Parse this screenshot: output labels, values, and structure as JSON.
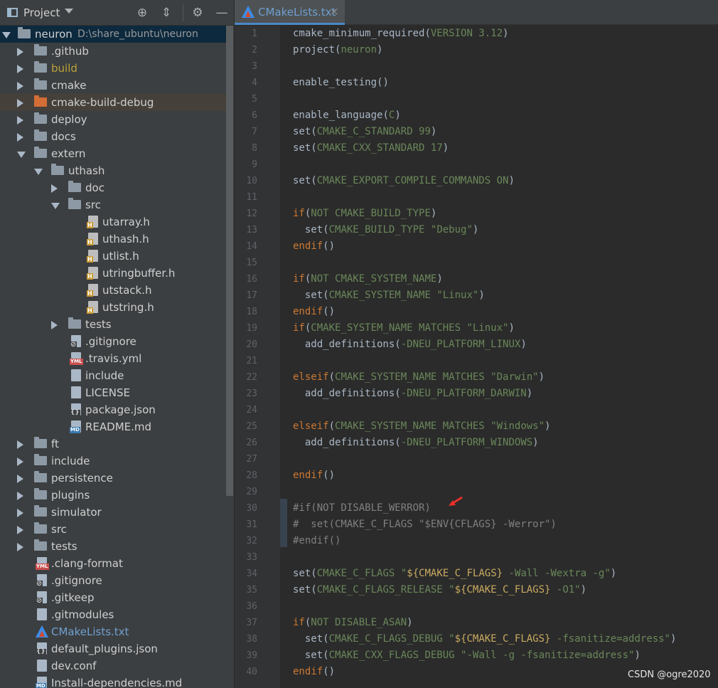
{
  "project": {
    "title": "Project",
    "root_label": "neuron",
    "root_path": "D:\\share_ubuntu\\neuron",
    "tree": [
      {
        "label": "neuron",
        "path": "D:\\share_ubuntu\\neuron",
        "depth": 0,
        "kind": "folder",
        "expanded": true,
        "selected": true
      },
      {
        "label": ".github",
        "depth": 1,
        "kind": "folder",
        "expanded": false
      },
      {
        "label": "build",
        "depth": 1,
        "kind": "folder",
        "expanded": false,
        "style": "build"
      },
      {
        "label": "cmake",
        "depth": 1,
        "kind": "folder",
        "expanded": false
      },
      {
        "label": "cmake-build-debug",
        "depth": 1,
        "kind": "folder",
        "expanded": false,
        "style": "orange",
        "highlight": true
      },
      {
        "label": "deploy",
        "depth": 1,
        "kind": "folder",
        "expanded": false
      },
      {
        "label": "docs",
        "depth": 1,
        "kind": "folder",
        "expanded": false
      },
      {
        "label": "extern",
        "depth": 1,
        "kind": "folder",
        "expanded": true
      },
      {
        "label": "uthash",
        "depth": 2,
        "kind": "folder",
        "expanded": true
      },
      {
        "label": "doc",
        "depth": 3,
        "kind": "folder",
        "expanded": false
      },
      {
        "label": "src",
        "depth": 3,
        "kind": "folder",
        "expanded": true
      },
      {
        "label": "utarray.h",
        "depth": 4,
        "kind": "h"
      },
      {
        "label": "uthash.h",
        "depth": 4,
        "kind": "h"
      },
      {
        "label": "utlist.h",
        "depth": 4,
        "kind": "h"
      },
      {
        "label": "utringbuffer.h",
        "depth": 4,
        "kind": "h"
      },
      {
        "label": "utstack.h",
        "depth": 4,
        "kind": "h"
      },
      {
        "label": "utstring.h",
        "depth": 4,
        "kind": "h"
      },
      {
        "label": "tests",
        "depth": 3,
        "kind": "folder",
        "expanded": false
      },
      {
        "label": ".gitignore",
        "depth": 3,
        "kind": "gitignore"
      },
      {
        "label": ".travis.yml",
        "depth": 3,
        "kind": "yml"
      },
      {
        "label": "include",
        "depth": 3,
        "kind": "text"
      },
      {
        "label": "LICENSE",
        "depth": 3,
        "kind": "text"
      },
      {
        "label": "package.json",
        "depth": 3,
        "kind": "json"
      },
      {
        "label": "README.md",
        "depth": 3,
        "kind": "md"
      },
      {
        "label": "ft",
        "depth": 1,
        "kind": "folder",
        "expanded": false
      },
      {
        "label": "include",
        "depth": 1,
        "kind": "folder",
        "expanded": false
      },
      {
        "label": "persistence",
        "depth": 1,
        "kind": "folder",
        "expanded": false
      },
      {
        "label": "plugins",
        "depth": 1,
        "kind": "folder",
        "expanded": false
      },
      {
        "label": "simulator",
        "depth": 1,
        "kind": "folder",
        "expanded": false
      },
      {
        "label": "src",
        "depth": 1,
        "kind": "folder",
        "expanded": false
      },
      {
        "label": "tests",
        "depth": 1,
        "kind": "folder",
        "expanded": false
      },
      {
        "label": ".clang-format",
        "depth": 1,
        "kind": "yml"
      },
      {
        "label": ".gitignore",
        "depth": 1,
        "kind": "gitignore"
      },
      {
        "label": ".gitkeep",
        "depth": 1,
        "kind": "gitignore"
      },
      {
        "label": ".gitmodules",
        "depth": 1,
        "kind": "text"
      },
      {
        "label": "CMakeLists.txt",
        "depth": 1,
        "kind": "cmake",
        "style": "cmlist"
      },
      {
        "label": "default_plugins.json",
        "depth": 1,
        "kind": "json"
      },
      {
        "label": "dev.conf",
        "depth": 1,
        "kind": "text"
      },
      {
        "label": "Install-dependencies.md",
        "depth": 1,
        "kind": "md"
      }
    ]
  },
  "editor": {
    "tab_label": "CMakeLists.txt",
    "tab_close": "×",
    "lines": [
      [
        [
          "fn",
          "cmake_minimum_required"
        ],
        [
          "p",
          "("
        ],
        [
          "arg",
          "VERSION 3.12"
        ],
        [
          "p",
          ")"
        ]
      ],
      [
        [
          "fn",
          "project"
        ],
        [
          "p",
          "("
        ],
        [
          "arg",
          "neuron"
        ],
        [
          "p",
          ")"
        ]
      ],
      [],
      [
        [
          "fn",
          "enable_testing"
        ],
        [
          "p",
          "()"
        ]
      ],
      [],
      [
        [
          "fn",
          "enable_language"
        ],
        [
          "p",
          "("
        ],
        [
          "arg",
          "C"
        ],
        [
          "p",
          ")"
        ]
      ],
      [
        [
          "fn",
          "set"
        ],
        [
          "p",
          "("
        ],
        [
          "arg",
          "CMAKE_C_STANDARD 99"
        ],
        [
          "p",
          ")"
        ]
      ],
      [
        [
          "fn",
          "set"
        ],
        [
          "p",
          "("
        ],
        [
          "arg",
          "CMAKE_CXX_STANDARD 17"
        ],
        [
          "p",
          ")"
        ]
      ],
      [],
      [
        [
          "fn",
          "set"
        ],
        [
          "p",
          "("
        ],
        [
          "arg",
          "CMAKE_EXPORT_COMPILE_COMMANDS ON"
        ],
        [
          "p",
          ")"
        ]
      ],
      [],
      [
        [
          "kw",
          "if"
        ],
        [
          "p",
          "("
        ],
        [
          "arg",
          "NOT CMAKE_BUILD_TYPE"
        ],
        [
          "p",
          ")"
        ]
      ],
      [
        [
          "p",
          "  "
        ],
        [
          "fn",
          "set"
        ],
        [
          "p",
          "("
        ],
        [
          "arg",
          "CMAKE_BUILD_TYPE "
        ],
        [
          "str",
          "\"Debug\""
        ],
        [
          "p",
          ")"
        ]
      ],
      [
        [
          "kw",
          "endif"
        ],
        [
          "p",
          "()"
        ]
      ],
      [],
      [
        [
          "kw",
          "if"
        ],
        [
          "p",
          "("
        ],
        [
          "arg",
          "NOT CMAKE_SYSTEM_NAME"
        ],
        [
          "p",
          ")"
        ]
      ],
      [
        [
          "p",
          "  "
        ],
        [
          "fn",
          "set"
        ],
        [
          "p",
          "("
        ],
        [
          "arg",
          "CMAKE_SYSTEM_NAME "
        ],
        [
          "str",
          "\"Linux\""
        ],
        [
          "p",
          ")"
        ]
      ],
      [
        [
          "kw",
          "endif"
        ],
        [
          "p",
          "()"
        ]
      ],
      [
        [
          "kw",
          "if"
        ],
        [
          "p",
          "("
        ],
        [
          "arg",
          "CMAKE_SYSTEM_NAME MATCHES "
        ],
        [
          "str",
          "\"Linux\""
        ],
        [
          "p",
          ")"
        ]
      ],
      [
        [
          "p",
          "  "
        ],
        [
          "fn",
          "add_definitions"
        ],
        [
          "p",
          "("
        ],
        [
          "arg",
          "-DNEU_PLATFORM_LINUX"
        ],
        [
          "p",
          ")"
        ]
      ],
      [],
      [
        [
          "kw",
          "elseif"
        ],
        [
          "p",
          "("
        ],
        [
          "arg",
          "CMAKE_SYSTEM_NAME MATCHES "
        ],
        [
          "str",
          "\"Darwin\""
        ],
        [
          "p",
          ")"
        ]
      ],
      [
        [
          "p",
          "  "
        ],
        [
          "fn",
          "add_definitions"
        ],
        [
          "p",
          "("
        ],
        [
          "arg",
          "-DNEU_PLATFORM_DARWIN"
        ],
        [
          "p",
          ")"
        ]
      ],
      [],
      [
        [
          "kw",
          "elseif"
        ],
        [
          "p",
          "("
        ],
        [
          "arg",
          "CMAKE_SYSTEM_NAME MATCHES "
        ],
        [
          "str",
          "\"Windows\""
        ],
        [
          "p",
          ")"
        ]
      ],
      [
        [
          "p",
          "  "
        ],
        [
          "fn",
          "add_definitions"
        ],
        [
          "p",
          "("
        ],
        [
          "arg",
          "-DNEU_PLATFORM_WINDOWS"
        ],
        [
          "p",
          ")"
        ]
      ],
      [],
      [
        [
          "kw",
          "endif"
        ],
        [
          "p",
          "()"
        ]
      ],
      [],
      [
        [
          "cm",
          "#if(NOT DISABLE_WERROR)"
        ]
      ],
      [
        [
          "cm",
          "#  set(CMAKE_C_FLAGS \"$ENV{CFLAGS} -Werror\")"
        ]
      ],
      [
        [
          "cm",
          "#endif()"
        ]
      ],
      [],
      [
        [
          "fn",
          "set"
        ],
        [
          "p",
          "("
        ],
        [
          "arg",
          "CMAKE_C_FLAGS "
        ],
        [
          "str",
          "\""
        ],
        [
          "def",
          "${CMAKE_C_FLAGS}"
        ],
        [
          "str",
          " -Wall -Wextra -g\""
        ],
        [
          "p",
          ")"
        ]
      ],
      [
        [
          "fn",
          "set"
        ],
        [
          "p",
          "("
        ],
        [
          "arg",
          "CMAKE_C_FLAGS_RELEASE "
        ],
        [
          "str",
          "\""
        ],
        [
          "def",
          "${CMAKE_C_FLAGS}"
        ],
        [
          "str",
          " -O1\""
        ],
        [
          "p",
          ")"
        ]
      ],
      [],
      [
        [
          "kw",
          "if"
        ],
        [
          "p",
          "("
        ],
        [
          "arg",
          "NOT DISABLE_ASAN"
        ],
        [
          "p",
          ")"
        ]
      ],
      [
        [
          "p",
          "  "
        ],
        [
          "fn",
          "set"
        ],
        [
          "p",
          "("
        ],
        [
          "arg",
          "CMAKE_C_FLAGS_DEBUG "
        ],
        [
          "str",
          "\""
        ],
        [
          "def",
          "${CMAKE_C_FLAGS}"
        ],
        [
          "str",
          " -fsanitize=address\""
        ],
        [
          "p",
          ")"
        ]
      ],
      [
        [
          "p",
          "  "
        ],
        [
          "fn",
          "set"
        ],
        [
          "p",
          "("
        ],
        [
          "arg",
          "CMAKE_CXX_FLAGS_DEBUG "
        ],
        [
          "str",
          "\"-Wall -g -fsanitize=address\""
        ],
        [
          "p",
          ")"
        ]
      ],
      [
        [
          "kw",
          "endif"
        ],
        [
          "p",
          "()"
        ]
      ]
    ]
  },
  "watermark": "CSDN @ogre2020",
  "colors": {
    "panel_bg": "#3c3f41",
    "editor_bg": "#2b2b2b",
    "selected_row": "#0d293e",
    "keyword": "#cc7832",
    "argument": "#6a8759",
    "comment": "#808080",
    "annotation_arrow": "#e8302a"
  }
}
